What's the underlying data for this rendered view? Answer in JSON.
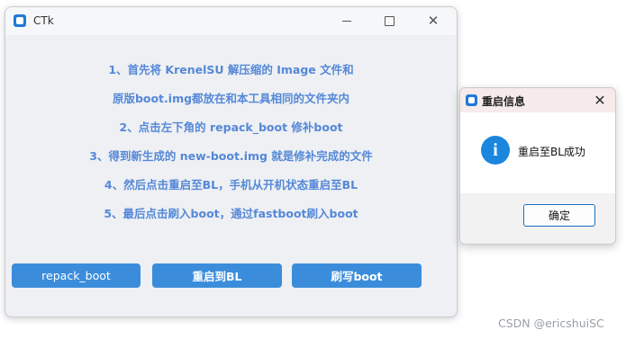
{
  "main_window": {
    "title": "CTk",
    "instructions": [
      "1、首先将 KrenelSU 解压缩的 Image 文件和",
      "原版boot.img都放在和本工具相同的文件夹内",
      "2、点击左下角的 repack_boot 修补boot",
      "3、得到新生成的 new-boot.img 就是修补完成的文件",
      "4、然后点击重启至BL，手机从开机状态重启至BL",
      "5、最后点击刷入boot，通过fastboot刷入boot"
    ],
    "buttons": {
      "repack": "repack_boot",
      "reboot": "重启到BL",
      "flash": "刷写boot"
    },
    "titlebar_controls": [
      "minimize",
      "maximize",
      "close"
    ]
  },
  "dialog": {
    "title": "重启信息",
    "message": "重启至BL成功",
    "ok_label": "确定",
    "icon": "info-icon"
  },
  "watermark": "CSDN @ericshuiSC",
  "colors": {
    "instruction_text": "#5588d8",
    "button_bg": "#3b8ddb",
    "info_icon": "#1a86de"
  }
}
